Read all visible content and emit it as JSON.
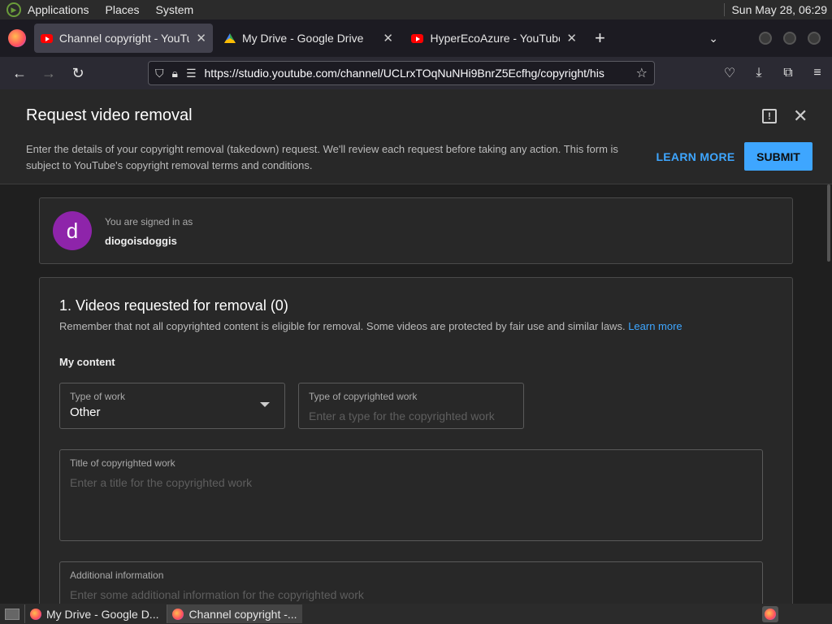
{
  "panel": {
    "menus": [
      "Applications",
      "Places",
      "System"
    ],
    "clock": "Sun May 28, 06:29"
  },
  "tabs": [
    {
      "label": "Channel copyright - YouTub",
      "icon": "youtube-icon"
    },
    {
      "label": "My Drive - Google Drive",
      "icon": "google-drive-icon"
    },
    {
      "label": "HyperEcoAzure - YouTube",
      "icon": "youtube-icon"
    }
  ],
  "url": "https://studio.youtube.com/channel/UCLrxTOqNuNHi9BnrZ5Ecfhg/copyright/his",
  "dialog": {
    "title": "Request video removal",
    "description": "Enter the details of your copyright removal (takedown) request. We'll review each request before taking any action. This form is subject to YouTube's copyright removal terms and conditions.",
    "learn_more": "LEARN MORE",
    "submit": "SUBMIT"
  },
  "account": {
    "avatar_letter": "d",
    "signed_in_label": "You are signed in as",
    "username": "diogoisdoggis"
  },
  "videos": {
    "title": "1. Videos requested for removal (0)",
    "note": "Remember that not all copyrighted content is eligible for removal. Some videos are protected by fair use and similar laws.",
    "note_link": "Learn more",
    "my_content": "My content",
    "type_of_work": {
      "label": "Type of work",
      "value": "Other"
    },
    "type_of_copyrighted_work": {
      "label": "Type of copyrighted work",
      "placeholder": "Enter a type for the copyrighted work"
    },
    "title_field": {
      "label": "Title of copyrighted work",
      "placeholder": "Enter a title for the copyrighted work"
    },
    "additional_info": {
      "label": "Additional information",
      "placeholder": "Enter some additional information for the copyrighted work"
    }
  },
  "taskbar": {
    "tasks": [
      "My Drive - Google D...",
      "Channel copyright -..."
    ]
  },
  "colors": {
    "accent": "#3ea6ff",
    "avatar": "#8e24aa"
  }
}
